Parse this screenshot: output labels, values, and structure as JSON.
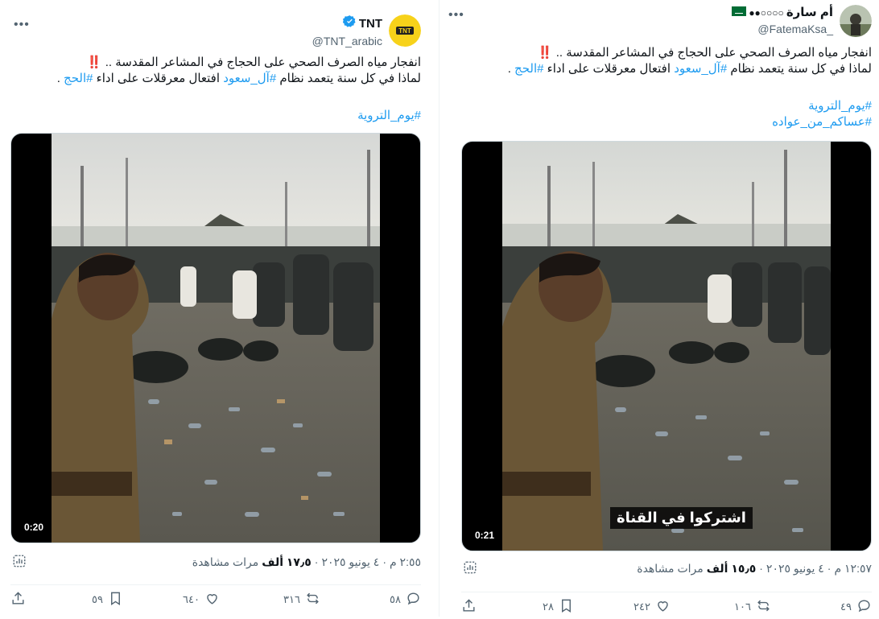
{
  "tweets": [
    {
      "display_name": "TNT",
      "handle": "@TNT_arabic",
      "avatar_text": "TNT",
      "line1": "انفجار مياه الصرف الصحي على الحجاج في المشاعر المقدسة ..",
      "line1_emoji": "‼️",
      "line2_a": "لماذا في كل سنة يتعمد نظام",
      "line2_tag1": "#آل_سعود",
      "line2_b": "افتعال معرقلات على اداء",
      "line2_tag2": "#الحج",
      "line2_c": ".",
      "hashtags": [
        "#يوم_التروية"
      ],
      "video_duration": "0:20",
      "video_caption": "",
      "time": "٢:٥٥ م",
      "date": "٤ يونيو ٢٠٢٥",
      "views_count": "١٧٫٥ ألف",
      "views_label": "مرات مشاهدة",
      "replies": "٥٨",
      "reposts": "٣١٦",
      "likes": "٦٤٠",
      "bookmarks": "٥٩"
    },
    {
      "display_name": "أم سارة",
      "handle": "@FatemaKsa_",
      "avatar_text": "",
      "line1": "انفجار مياه الصرف الصحي على الحجاج في المشاعر المقدسة ..",
      "line1_emoji": "‼️",
      "line2_a": "لماذا في كل سنة يتعمد نظام",
      "line2_tag1": "#آل_سعود",
      "line2_b": "افتعال معرقلات على اداء",
      "line2_tag2": "#الحج",
      "line2_c": ".",
      "hashtags": [
        "#يوم_التروية",
        "#عساكم_من_عواده"
      ],
      "video_duration": "0:21",
      "video_caption": "اشتركوا في القناة",
      "time": "١٢:٥٧ م",
      "date": "٤ يونيو ٢٠٢٥",
      "views_count": "١٥٫٥ ألف",
      "views_label": "مرات مشاهدة",
      "replies": "٤٩",
      "reposts": "١٠٦",
      "likes": "٢٤٢",
      "bookmarks": "٢٨"
    }
  ],
  "colors": {
    "accent": "#1d9bf0",
    "verified": "#1d9bf0",
    "muted": "#536471",
    "tnt_yellow": "#f7d21a"
  },
  "icons": [
    "verified-badge-icon",
    "more-icon",
    "analytics-icon",
    "share-icon",
    "bookmark-icon",
    "like-icon",
    "repost-icon",
    "reply-icon",
    "flag-icon"
  ]
}
